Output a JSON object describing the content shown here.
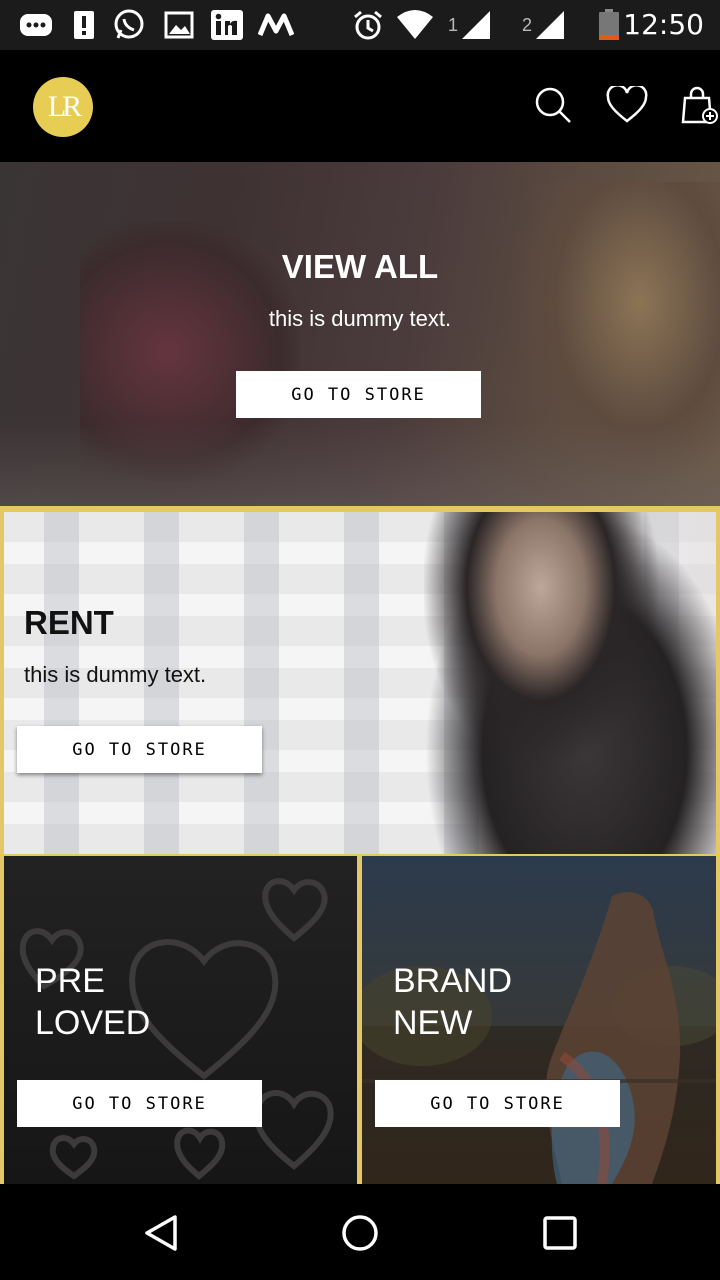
{
  "status_bar": {
    "time": "12:50",
    "signal1_label": "1",
    "signal2_label": "2",
    "icons": [
      "chat-icon",
      "alert-icon",
      "whatsapp-icon",
      "gallery-icon",
      "linkedin-icon",
      "myntra-icon",
      "alarm-icon",
      "wifi-icon",
      "signal-icon",
      "battery-icon"
    ]
  },
  "header": {
    "logo_text": "LR",
    "icons": [
      "search-icon",
      "heart-icon",
      "cart-icon"
    ]
  },
  "hero": {
    "title": "VIEW ALL",
    "subtitle": "this is dummy text.",
    "button_label": "GO TO STORE"
  },
  "rent": {
    "title": "RENT",
    "subtitle": "this is dummy text.",
    "button_label": "GO TO STORE"
  },
  "pre_loved": {
    "title_line1": "PRE",
    "title_line2": "LOVED",
    "button_label": "GO TO STORE"
  },
  "brand_new": {
    "title_line1": "BRAND",
    "title_line2": "NEW",
    "button_label": "GO TO STORE"
  },
  "nav": {
    "icons": [
      "back-icon",
      "home-icon",
      "recents-icon"
    ]
  },
  "colors": {
    "accent": "#e3c865",
    "logo": "#e8cd55",
    "header_bg": "#000000",
    "button_bg": "#ffffff"
  }
}
